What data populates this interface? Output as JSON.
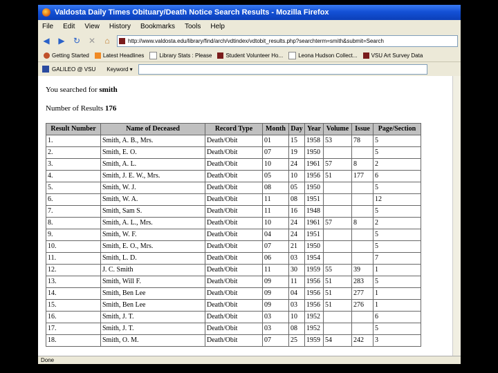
{
  "window": {
    "title": "Valdosta Daily Times Obituary/Death Notice Search Results - Mozilla Firefox",
    "status": "Done"
  },
  "menu": [
    "File",
    "Edit",
    "View",
    "History",
    "Bookmarks",
    "Tools",
    "Help"
  ],
  "url": "http://www.valdosta.edu/library/find/arch/vdtindex/vdtobit_results.php?searchterm=smith&submit=Search",
  "bookmarks": [
    "Getting Started",
    "Latest Headlines",
    "Library Stats : Please",
    "Student Volunteer Ho...",
    "Leona Hudson Collect...",
    "VSU Art Survey Data"
  ],
  "toolbar2": {
    "galileo": "GALILEO @ VSU",
    "search_label": "Keyword"
  },
  "page": {
    "searched_prefix": "You searched for ",
    "term": "smith",
    "results_prefix": "Number of Results ",
    "count": "176"
  },
  "table": {
    "headers": [
      "Result Number",
      "Name of Deceased",
      "Record Type",
      "Month",
      "Day",
      "Year",
      "Volume",
      "Issue",
      "Page/Section"
    ],
    "rows": [
      [
        "1.",
        "Smith, A. B., Mrs.",
        "Death/Obit",
        "01",
        "15",
        "1958",
        "53",
        "78",
        "5"
      ],
      [
        "2.",
        "Smith, E. O.",
        "Death/Obit",
        "07",
        "19",
        "1950",
        "",
        "",
        "5"
      ],
      [
        "3.",
        "Smith, A. L.",
        "Death/Obit",
        "10",
        "24",
        "1961",
        "57",
        "8",
        "2"
      ],
      [
        "4.",
        "Smith, J. E. W., Mrs.",
        "Death/Obit",
        "05",
        "10",
        "1956",
        "51",
        "177",
        "6"
      ],
      [
        "5.",
        "Smith, W. J.",
        "Death/Obit",
        "08",
        "05",
        "1950",
        "",
        "",
        "5"
      ],
      [
        "6.",
        "Smith, W. A.",
        "Death/Obit",
        "11",
        "08",
        "1951",
        "",
        "",
        "12"
      ],
      [
        "7.",
        "Smith, Sam S.",
        "Death/Obit",
        "11",
        "16",
        "1948",
        "",
        "",
        "5"
      ],
      [
        "8.",
        "Smith, A. L., Mrs.",
        "Death/Obit",
        "10",
        "24",
        "1961",
        "57",
        "8",
        "2"
      ],
      [
        "9.",
        "Smith, W. F.",
        "Death/Obit",
        "04",
        "24",
        "1951",
        "",
        "",
        "5"
      ],
      [
        "10.",
        "Smith, E. O., Mrs.",
        "Death/Obit",
        "07",
        "21",
        "1950",
        "",
        "",
        "5"
      ],
      [
        "11.",
        "Smith, L. D.",
        "Death/Obit",
        "06",
        "03",
        "1954",
        "",
        "",
        "7"
      ],
      [
        "12.",
        "J. C. Smith",
        "Death/Obit",
        "11",
        "30",
        "1959",
        "55",
        "39",
        "1"
      ],
      [
        "13.",
        "Smith, Will F.",
        "Death/Obit",
        "09",
        "11",
        "1956",
        "51",
        "283",
        "5"
      ],
      [
        "14.",
        "Smith, Ben Lee",
        "Death/Obit",
        "09",
        "04",
        "1956",
        "51",
        "277",
        "1"
      ],
      [
        "15.",
        "Smith, Ben Lee",
        "Death/Obit",
        "09",
        "03",
        "1956",
        "51",
        "276",
        "1"
      ],
      [
        "16.",
        "Smith, J. T.",
        "Death/Obit",
        "03",
        "10",
        "1952",
        "",
        "",
        "6"
      ],
      [
        "17.",
        "Smith, J. T.",
        "Death/Obit",
        "03",
        "08",
        "1952",
        "",
        "",
        "5"
      ],
      [
        "18.",
        "Smith, O. M.",
        "Death/Obit",
        "07",
        "25",
        "1959",
        "54",
        "242",
        "3"
      ]
    ]
  }
}
